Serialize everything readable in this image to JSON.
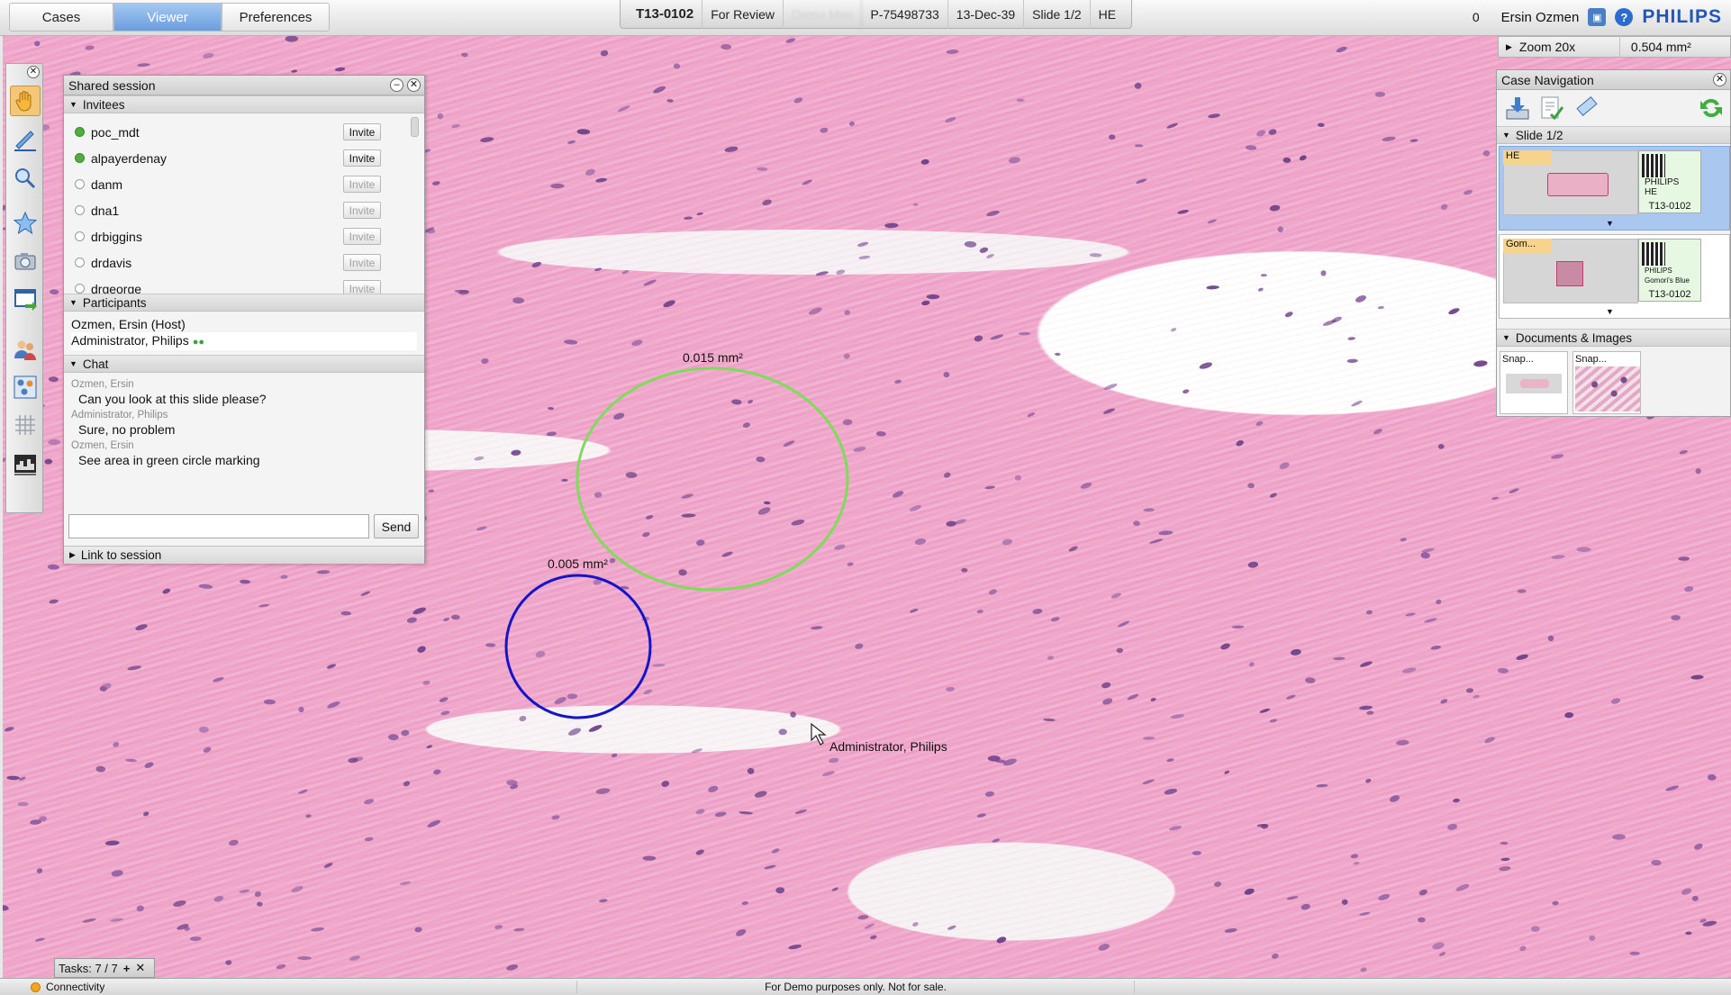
{
  "top_tabs": [
    "Cases",
    "Viewer",
    "Preferences"
  ],
  "case_info": {
    "case_id": "T13-0102",
    "status": "For Review",
    "patient_name": "Demo Man",
    "patient_id": "P-75498733",
    "date": "13-Dec-39",
    "slide": "Slide 1/2",
    "stain": "HE"
  },
  "header": {
    "count": "0",
    "user": "Ersin Ozmen",
    "brand": "PHILIPS"
  },
  "zoom": {
    "level": "Zoom 20x",
    "area": "0.504 mm²"
  },
  "shared_session": {
    "title": "Shared session",
    "invitees_label": "Invitees",
    "invite_label": "Invite",
    "invitees": [
      {
        "name": "poc_mdt",
        "online": true
      },
      {
        "name": "alpayerdenay",
        "online": true
      },
      {
        "name": "danm",
        "online": false
      },
      {
        "name": "dna1",
        "online": false
      },
      {
        "name": "drbiggins",
        "online": false
      },
      {
        "name": "drdavis",
        "online": false
      },
      {
        "name": "drgeorge",
        "online": false
      }
    ],
    "participants_label": "Participants",
    "participants": [
      "Ozmen, Ersin (Host)",
      "Administrator, Philips"
    ],
    "chat_label": "Chat",
    "messages": [
      {
        "author": "Ozmen, Ersin",
        "text": "Can you look at this slide please?"
      },
      {
        "author": "Administrator, Philips",
        "text": "Sure, no problem"
      },
      {
        "author": "Ozmen, Ersin",
        "text": "See area in green circle marking"
      }
    ],
    "chat_input_value": "",
    "send_label": "Send",
    "link_label": "Link to session"
  },
  "case_navigation": {
    "title": "Case Navigation",
    "slide_section": "Slide 1/2",
    "slides": [
      {
        "label": "HE",
        "barcode_brand": "PHILIPS",
        "barcode_stain": "HE",
        "barcode_id": "T13-0102"
      },
      {
        "label": "Gom...",
        "barcode_brand": "PHILIPS",
        "barcode_stain": "Gomori's Blue",
        "barcode_id": "T13-0102"
      }
    ],
    "docs_section": "Documents & Images",
    "docs": [
      "Snap...",
      "Snap..."
    ]
  },
  "annotations": [
    {
      "label": "0.015 mm²",
      "color": "#7fdc5a"
    },
    {
      "label": "0.005 mm²",
      "color": "#1515c8"
    }
  ],
  "remote_cursor_user": "Administrator, Philips",
  "tasks": {
    "label": "Tasks: 7 / 7"
  },
  "status": {
    "connectivity": "Connectivity",
    "demo_notice": "For Demo purposes only. Not for sale."
  }
}
